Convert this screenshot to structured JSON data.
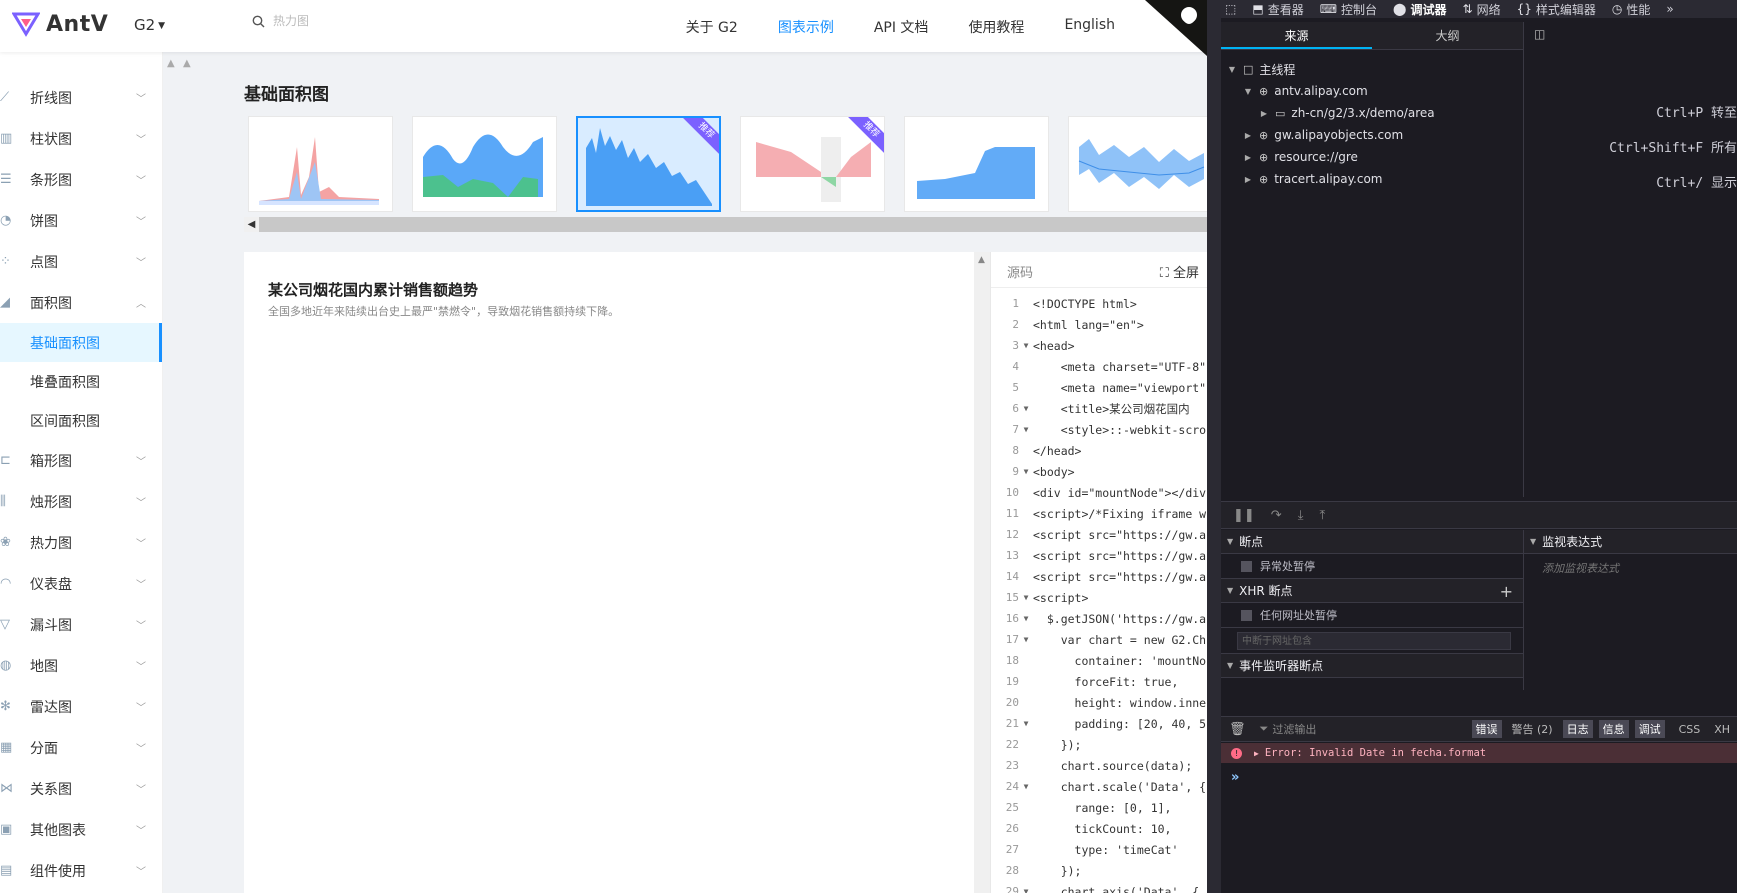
{
  "topbar": {
    "brand": "AntV",
    "version": "G2",
    "search_placeholder": "热力图",
    "nav": [
      {
        "label": "关于 G2",
        "active": false
      },
      {
        "label": "图表示例",
        "active": true
      },
      {
        "label": "API 文档",
        "active": false
      },
      {
        "label": "使用教程",
        "active": false
      },
      {
        "label": "English",
        "active": false
      }
    ]
  },
  "sidebar": {
    "items": [
      {
        "label": "折线图",
        "icon": "line-chart-icon"
      },
      {
        "label": "柱状图",
        "icon": "column-chart-icon"
      },
      {
        "label": "条形图",
        "icon": "bar-chart-icon"
      },
      {
        "label": "饼图",
        "icon": "pie-chart-icon"
      },
      {
        "label": "点图",
        "icon": "scatter-chart-icon"
      },
      {
        "label": "面积图",
        "icon": "area-chart-icon",
        "expanded": true
      }
    ],
    "sub_items": [
      {
        "label": "基础面积图",
        "active": true
      },
      {
        "label": "堆叠面积图",
        "active": false
      },
      {
        "label": "区间面积图",
        "active": false
      }
    ],
    "items_after": [
      {
        "label": "箱形图",
        "icon": "box-chart-icon"
      },
      {
        "label": "烛形图",
        "icon": "candlestick-chart-icon"
      },
      {
        "label": "热力图",
        "icon": "heatmap-icon"
      },
      {
        "label": "仪表盘",
        "icon": "gauge-icon"
      },
      {
        "label": "漏斗图",
        "icon": "funnel-icon"
      },
      {
        "label": "地图",
        "icon": "map-icon"
      },
      {
        "label": "雷达图",
        "icon": "radar-icon"
      },
      {
        "label": "分面",
        "icon": "facet-icon"
      },
      {
        "label": "关系图",
        "icon": "relation-icon"
      },
      {
        "label": "其他图表",
        "icon": "other-chart-icon"
      },
      {
        "label": "组件使用",
        "icon": "component-icon"
      }
    ]
  },
  "main": {
    "title": "基础面积图",
    "thumb_badge": "推荐",
    "chart_title": "某公司烟花国内累计销售额趋势",
    "chart_subtitle": "全国多地近年来陆续出台史上最严\"禁燃令\"，导致烟花销售额持续下降。",
    "source_label": "源码",
    "fullscreen_label": "全屏",
    "code_lines": [
      "<!DOCTYPE html>",
      "<html lang=\"en\">",
      "<head>",
      "    <meta charset=\"UTF-8\"",
      "    <meta name=\"viewport\"",
      "    <title>某公司烟花国内",
      "    <style>::-webkit-scro",
      "</head>",
      "<body>",
      "<div id=\"mountNode\"></div",
      "<script>/*Fixing iframe w",
      "<script src=\"https://gw.a",
      "<script src=\"https://gw.a",
      "<script src=\"https://gw.a",
      "<script>",
      "  $.getJSON('https://gw.a",
      "    var chart = new G2.Ch",
      "      container: 'mountNo",
      "      forceFit: true,",
      "      height: window.inne",
      "      padding: [20, 40, 5",
      "    });",
      "    chart.source(data);",
      "    chart.scale('Data', {",
      "      range: [0, 1],",
      "      tickCount: 10,",
      "      type: 'timeCat'",
      "    });",
      "    chart.axis('Data', {"
    ],
    "fold_lines": [
      3,
      6,
      7,
      9,
      15,
      16,
      17,
      21,
      24,
      29
    ]
  },
  "devtools": {
    "tabs": [
      {
        "label": "查看器",
        "icon": "inspector-icon"
      },
      {
        "label": "控制台",
        "icon": "console-icon"
      },
      {
        "label": "调试器",
        "icon": "debugger-icon",
        "active": true
      },
      {
        "label": "网络",
        "icon": "network-icon"
      },
      {
        "label": "样式编辑器",
        "icon": "style-editor-icon"
      },
      {
        "label": "性能",
        "icon": "performance-icon"
      }
    ],
    "source_tabs": [
      "来源",
      "大纲"
    ],
    "tree": [
      {
        "label": "主线程",
        "depth": 0,
        "twisty": "▼",
        "icon": "□"
      },
      {
        "label": "antv.alipay.com",
        "depth": 1,
        "twisty": "▼",
        "icon": "⊕"
      },
      {
        "label": "zh-cn/g2/3.x/demo/area",
        "depth": 2,
        "twisty": "▶",
        "icon": "▭"
      },
      {
        "label": "gw.alipayobjects.com",
        "depth": 1,
        "twisty": "▶",
        "icon": "⊕"
      },
      {
        "label": "resource://gre",
        "depth": 1,
        "twisty": "▶",
        "icon": "⊕"
      },
      {
        "label": "tracert.alipay.com",
        "depth": 1,
        "twisty": "▶",
        "icon": "⊕"
      }
    ],
    "shortcuts": [
      {
        "keys": "Ctrl+P",
        "desc": "转至"
      },
      {
        "keys": "Ctrl+Shift+F",
        "desc": "所有"
      },
      {
        "keys": "Ctrl+/",
        "desc": "显示"
      }
    ],
    "breakpoints_label": "断点",
    "pause_on_exception": "异常处暂停",
    "xhr_breakpoints": "XHR 断点",
    "pause_any_url": "任何网址处暂停",
    "url_filter_placeholder": "中断于网址包含",
    "event_breakpoints": "事件监听器断点",
    "watch_label": "监视表达式",
    "watch_placeholder": "添加监视表达式",
    "console": {
      "filter_placeholder": "过滤输出",
      "levels": [
        {
          "label": "错误",
          "on": true
        },
        {
          "label": "警告 (2)",
          "on": false
        },
        {
          "label": "日志",
          "on": true
        },
        {
          "label": "信息",
          "on": true
        },
        {
          "label": "调试",
          "on": true
        }
      ],
      "extra": [
        "CSS",
        "XH"
      ],
      "error_message": "Error: Invalid Date in fecha.format"
    }
  }
}
